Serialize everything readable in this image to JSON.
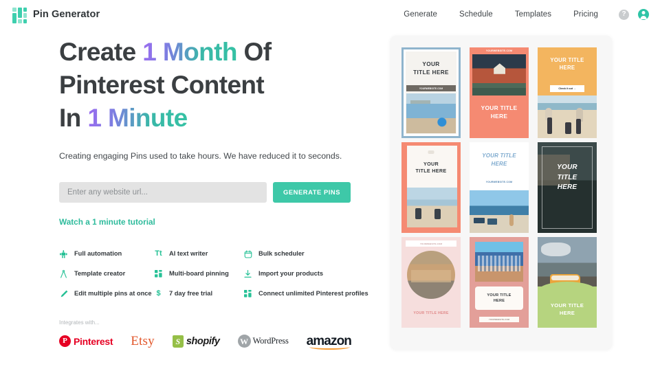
{
  "header": {
    "brand": "Pin Generator",
    "logo_color": "#3ecfae",
    "nav": [
      {
        "label": "Generate"
      },
      {
        "label": "Schedule"
      },
      {
        "label": "Templates"
      },
      {
        "label": "Pricing"
      }
    ],
    "help_icon": "question-mark",
    "help_glyph": "?",
    "avatar_icon": "user-avatar"
  },
  "hero": {
    "headline": {
      "line1_a": "Create ",
      "line1_grad": "1 Month",
      "line1_b": " Of",
      "line2": "Pinterest Content",
      "line3_a": "In ",
      "line3_grad": "1 Minute"
    },
    "subhead": "Creating engaging Pins used to take hours. We have reduced it to seconds.",
    "input_placeholder": "Enter any website url...",
    "input_value": "",
    "generate_button": "GENERATE PINS",
    "tutorial_link": "Watch a 1 minute tutorial",
    "accent_color": "#3ec8a8",
    "gradient_from": "#9b6cf0",
    "gradient_to": "#35c2a4"
  },
  "features": [
    {
      "icon": "robot-icon",
      "label": "Full automation"
    },
    {
      "icon": "text-writer-icon",
      "label": "AI text writer"
    },
    {
      "icon": "clock-icon",
      "label": "Bulk scheduler"
    },
    {
      "icon": "compass-icon",
      "label": "Template creator"
    },
    {
      "icon": "grid-icon",
      "label": "Multi-board pinning"
    },
    {
      "icon": "download-icon",
      "label": "Import your products"
    },
    {
      "icon": "pencil-icon",
      "label": "Edit multiple pins at once"
    },
    {
      "icon": "dollar-icon",
      "label": "7 day free trial"
    },
    {
      "icon": "grid-icon",
      "label": "Connect unlimited Pinterest profiles"
    }
  ],
  "integrations": {
    "caption": "Integrates with...",
    "logos": [
      {
        "name": "pinterest-logo",
        "text": "Pinterest",
        "mark": "P",
        "color": "#e60023"
      },
      {
        "name": "etsy-logo",
        "text": "Etsy",
        "color": "#e2562a"
      },
      {
        "name": "shopify-logo",
        "text": "shopify",
        "mark": "S",
        "color": "#95bf47"
      },
      {
        "name": "wordpress-logo",
        "text": "WordPress",
        "mark": "W",
        "color": "#23282d"
      },
      {
        "name": "amazon-logo",
        "text": "amazon",
        "color": "#131a22"
      }
    ]
  },
  "pins": {
    "panel_bg": "#f7f7f7",
    "items": [
      {
        "name": "pin-blue-frame",
        "title": "YOUR\nTITLE HERE",
        "title_l1": "YOUR",
        "title_l2": "TITLE HERE",
        "url": "YOURWEBSITE.COM",
        "bg": "#8fb4cd"
      },
      {
        "name": "pin-coral-top",
        "title_l1": "YOUR TITLE",
        "title_l2": "HERE",
        "url": "YOURWEBSITE.COM",
        "bg": "#f58a72"
      },
      {
        "name": "pin-yellow",
        "title_l1": "YOUR TITLE",
        "title_l2": "HERE",
        "cta": "Check it out →",
        "bg": "#f3b55f"
      },
      {
        "name": "pin-coral-frame",
        "title_l1": "YOUR",
        "title_l2": "TITLE HERE",
        "bg": "#f58a72"
      },
      {
        "name": "pin-white-blue",
        "title_l1": "YOUR TITLE",
        "title_l2": "HERE",
        "url": "YOURWEBSITE.COM",
        "bg": "#ffffff"
      },
      {
        "name": "pin-dark-photo",
        "title_l1": "YOUR",
        "title_l2": "TITLE",
        "title_l3": "HERE",
        "bg": "#2e3a36"
      },
      {
        "name": "pin-pink-circle",
        "title_l1": "YOUR TITLE HERE",
        "url": "YOURWEBSITE.COM",
        "bg": "#f6dedd"
      },
      {
        "name": "pin-rose-card",
        "title_l1": "YOUR TITLE",
        "title_l2": "HERE",
        "url": "YOURWEBSITE.COM",
        "bg": "#e39f99"
      },
      {
        "name": "pin-green-van",
        "title_l1": "YOUR TITLE",
        "title_l2": "HERE",
        "bg": "#b6d47f"
      }
    ]
  }
}
